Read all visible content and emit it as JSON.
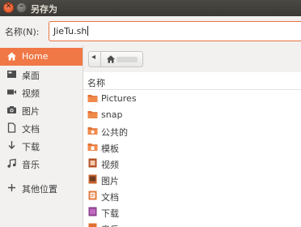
{
  "window": {
    "title": "另存为",
    "close_glyph": "✕",
    "minimize_glyph": "–"
  },
  "name_field": {
    "label": "名称(N):",
    "value": "JieTu.sh"
  },
  "sidebar": {
    "items": [
      {
        "label": "Home",
        "icon": "home-icon",
        "active": true
      },
      {
        "label": "桌面",
        "icon": "desktop-icon"
      },
      {
        "label": "视频",
        "icon": "video-icon"
      },
      {
        "label": "图片",
        "icon": "camera-icon"
      },
      {
        "label": "文档",
        "icon": "document-icon"
      },
      {
        "label": "下载",
        "icon": "download-icon"
      },
      {
        "label": "音乐",
        "icon": "music-icon"
      },
      {
        "label": "其他位置",
        "icon": "plus-icon"
      }
    ]
  },
  "pathbar": {
    "back_glyph": "◂",
    "home_icon": "home-icon"
  },
  "file_list": {
    "column_header": "名称",
    "rows": [
      {
        "name": "Pictures",
        "icon": "folder-icon"
      },
      {
        "name": "snap",
        "icon": "folder-icon"
      },
      {
        "name": "公共的",
        "icon": "public-folder-icon"
      },
      {
        "name": "模板",
        "icon": "templates-folder-icon"
      },
      {
        "name": "视频",
        "icon": "videos-folder-icon"
      },
      {
        "name": "图片",
        "icon": "pictures-folder-icon"
      },
      {
        "name": "文档",
        "icon": "documents-folder-icon"
      },
      {
        "name": "下载",
        "icon": "downloads-folder-icon"
      },
      {
        "name": "音乐",
        "icon": "music-folder-icon"
      }
    ]
  },
  "colors": {
    "accent": "#f07746",
    "titlebar": "#3c3b37",
    "folder": "#e06f30"
  }
}
